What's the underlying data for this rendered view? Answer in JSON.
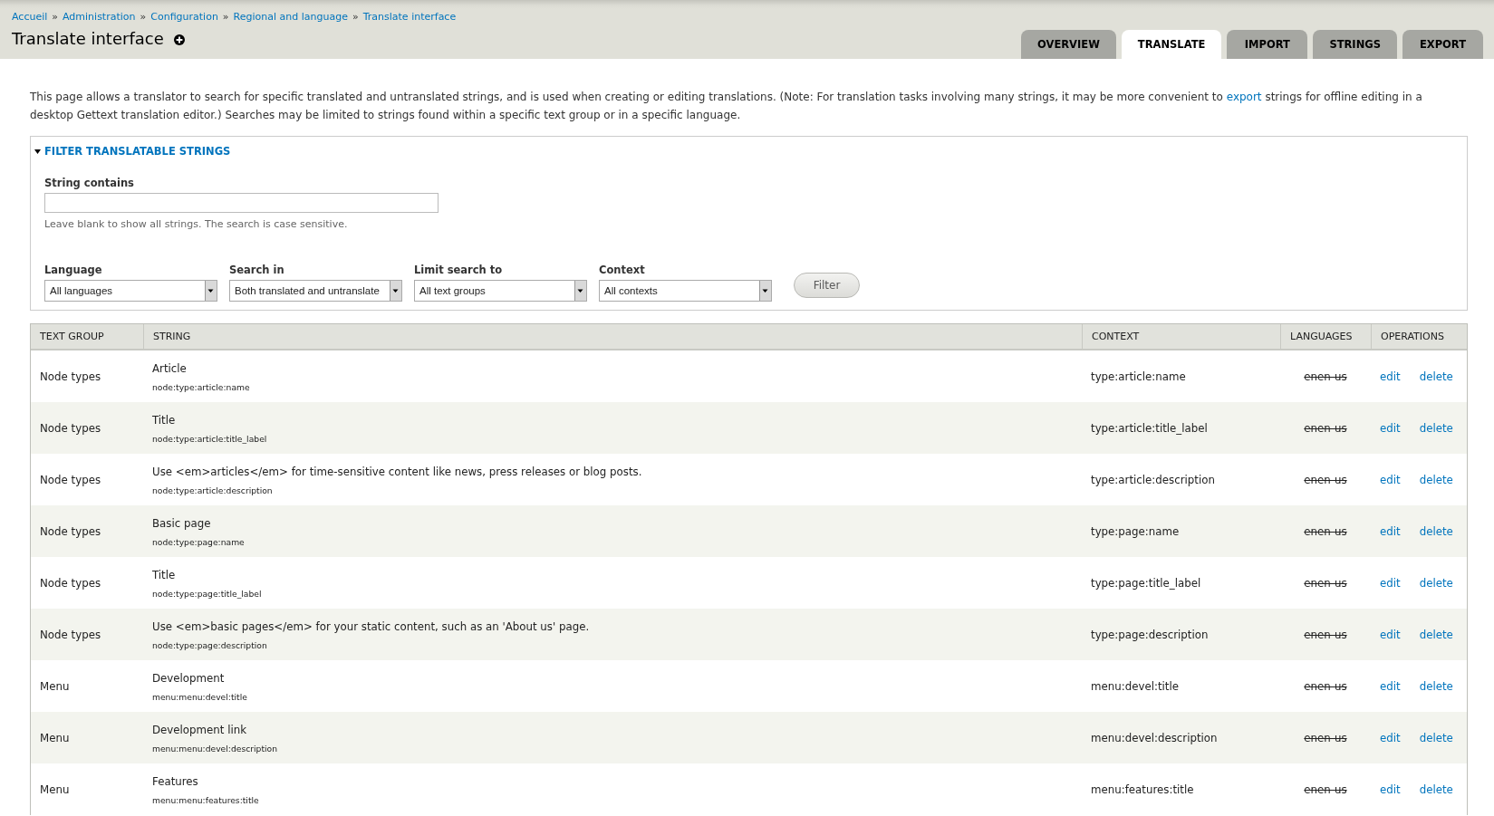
{
  "breadcrumb": [
    {
      "label": "Accueil"
    },
    {
      "separator": "»",
      "label": "Administration"
    },
    {
      "separator": "»",
      "label": "Configuration"
    },
    {
      "separator": "»",
      "label": "Regional and language"
    },
    {
      "separator": "»",
      "label": "Translate interface"
    }
  ],
  "page_title": "Translate interface",
  "tabs": [
    {
      "label": "OVERVIEW",
      "selected": false
    },
    {
      "label": "TRANSLATE",
      "selected": true
    },
    {
      "label": "IMPORT",
      "selected": false
    },
    {
      "label": "STRINGS",
      "selected": false
    },
    {
      "label": "EXPORT",
      "selected": false
    }
  ],
  "description": {
    "before": "This page allows a translator to search for specific translated and untranslated strings, and is used when creating or editing translations. (Note: For translation tasks involving many strings, it may be more convenient to ",
    "link": "export",
    "after": " strings for offline editing in a desktop Gettext translation editor.) Searches may be limited to strings found within a specific text group or in a specific language."
  },
  "filter": {
    "legend": "FILTER TRANSLATABLE STRINGS",
    "expanded": true,
    "string_contains": {
      "label": "String contains",
      "hint": "Leave blank to show all strings. The search is case sensitive."
    },
    "selects": [
      {
        "label": "Language",
        "value": "All languages"
      },
      {
        "label": "Search in",
        "value": "Both translated and untranslate"
      },
      {
        "label": "Limit search to",
        "value": "All text groups"
      },
      {
        "label": "Context",
        "value": "All contexts"
      }
    ],
    "button": "Filter"
  },
  "table": {
    "columns": [
      "TEXT GROUP",
      "STRING",
      "CONTEXT",
      "LANGUAGES",
      "OPERATIONS"
    ],
    "rows": [
      {
        "text_group": "Node types",
        "string": "Article",
        "key": "node:type:article:name",
        "context": "type:article:name",
        "languages": [
          {
            "code": "en",
            "translated": false
          },
          {
            "code": "en-us",
            "translated": false
          }
        ],
        "operations": [
          "edit",
          "delete"
        ]
      },
      {
        "text_group": "Node types",
        "string": "Title",
        "key": "node:type:article:title_label",
        "context": "type:article:title_label",
        "languages": [
          {
            "code": "en",
            "translated": false
          },
          {
            "code": "en-us",
            "translated": false
          }
        ],
        "operations": [
          "edit",
          "delete"
        ]
      },
      {
        "text_group": "Node types",
        "string": "Use <em>articles</em> for time-sensitive content like news, press releases or blog posts.",
        "key": "node:type:article:description",
        "context": "type:article:description",
        "languages": [
          {
            "code": "en",
            "translated": false
          },
          {
            "code": "en-us",
            "translated": false
          }
        ],
        "operations": [
          "edit",
          "delete"
        ]
      },
      {
        "text_group": "Node types",
        "string": "Basic page",
        "key": "node:type:page:name",
        "context": "type:page:name",
        "languages": [
          {
            "code": "en",
            "translated": false
          },
          {
            "code": "en-us",
            "translated": false
          }
        ],
        "operations": [
          "edit",
          "delete"
        ]
      },
      {
        "text_group": "Node types",
        "string": "Title",
        "key": "node:type:page:title_label",
        "context": "type:page:title_label",
        "languages": [
          {
            "code": "en",
            "translated": false
          },
          {
            "code": "en-us",
            "translated": false
          }
        ],
        "operations": [
          "edit",
          "delete"
        ]
      },
      {
        "text_group": "Node types",
        "string": "Use <em>basic pages</em> for your static content, such as an 'About us' page.",
        "key": "node:type:page:description",
        "context": "type:page:description",
        "languages": [
          {
            "code": "en",
            "translated": false
          },
          {
            "code": "en-us",
            "translated": false
          }
        ],
        "operations": [
          "edit",
          "delete"
        ]
      },
      {
        "text_group": "Menu",
        "string": "Development",
        "key": "menu:menu:devel:title",
        "context": "menu:devel:title",
        "languages": [
          {
            "code": "en",
            "translated": false
          },
          {
            "code": "en-us",
            "translated": false
          }
        ],
        "operations": [
          "edit",
          "delete"
        ]
      },
      {
        "text_group": "Menu",
        "string": "Development link",
        "key": "menu:menu:devel:description",
        "context": "menu:devel:description",
        "languages": [
          {
            "code": "en",
            "translated": false
          },
          {
            "code": "en-us",
            "translated": false
          }
        ],
        "operations": [
          "edit",
          "delete"
        ]
      },
      {
        "text_group": "Menu",
        "string": "Features",
        "key": "menu:menu:features:title",
        "context": "menu:features:title",
        "languages": [
          {
            "code": "en",
            "translated": false
          },
          {
            "code": "en-us",
            "translated": false
          }
        ],
        "operations": [
          "edit",
          "delete"
        ]
      }
    ]
  }
}
